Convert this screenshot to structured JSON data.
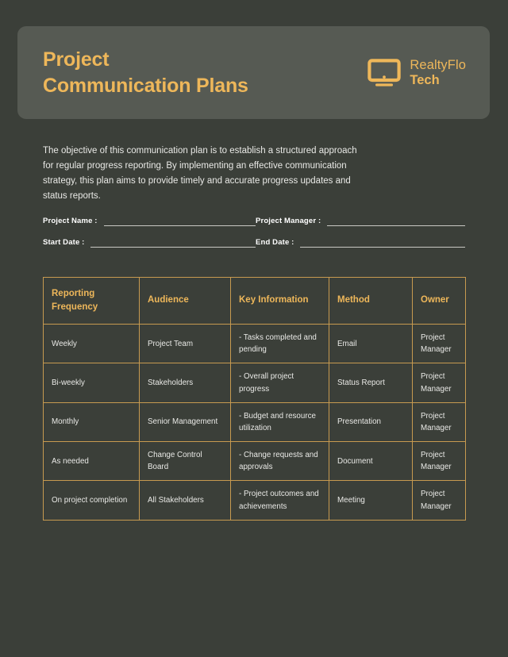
{
  "theme": {
    "page_bg": "#3b3f39",
    "card_bg": "#565a53",
    "accent": "#eeb75a",
    "border": "#c79a50",
    "text": "#e9e9e6"
  },
  "header": {
    "title_line1": "Project",
    "title_line2": "Communication Plans",
    "brand": {
      "icon": "monitor-icon",
      "name": "RealtyFlo",
      "sub": "Tech"
    }
  },
  "intro": {
    "paragraph": "The objective of this communication plan is to establish a structured approach for regular progress reporting. By implementing an effective communication strategy, this plan aims to provide timely and accurate progress updates and status reports."
  },
  "form": {
    "fields": [
      {
        "label": "Project Name :",
        "value": ""
      },
      {
        "label": "Project Manager :",
        "value": ""
      },
      {
        "label": "Start Date :",
        "value": ""
      },
      {
        "label": "End Date :",
        "value": ""
      }
    ]
  },
  "table": {
    "headers": [
      "Reporting Frequency",
      "Audience",
      "Key Information",
      "Method",
      "Owner"
    ],
    "rows": [
      {
        "frequency": "Weekly",
        "audience": "Project Team",
        "key_information": "- Tasks completed and pending",
        "method": "Email",
        "owner": "Project Manager"
      },
      {
        "frequency": "Bi-weekly",
        "audience": "Stakeholders",
        "key_information": "- Overall project progress",
        "method": "Status Report",
        "owner": "Project Manager"
      },
      {
        "frequency": "Monthly",
        "audience": "Senior Management",
        "key_information": "- Budget and resource utilization",
        "method": "Presentation",
        "owner": "Project Manager"
      },
      {
        "frequency": "As needed",
        "audience": "Change Control Board",
        "key_information": "- Change requests and approvals",
        "method": "Document",
        "owner": "Project Manager"
      },
      {
        "frequency": "On project completion",
        "audience": "All Stakeholders",
        "key_information": "- Project outcomes and achievements",
        "method": "Meeting",
        "owner": "Project Manager"
      }
    ]
  }
}
